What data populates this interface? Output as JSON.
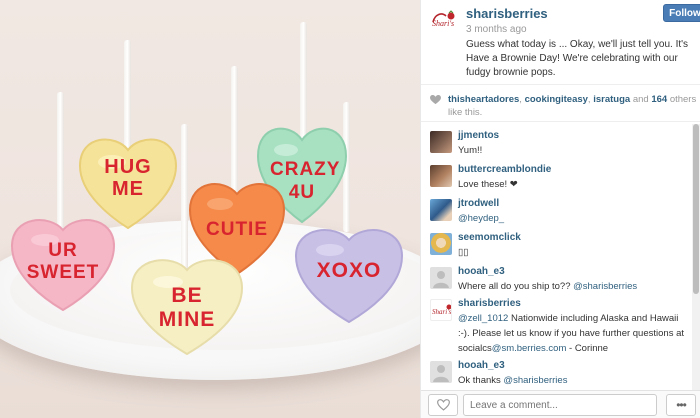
{
  "post": {
    "username": "sharisberries",
    "time": "3 months ago",
    "caption": "Guess what today is ... Okay, we'll just tell you. It's Have a Brownie Day! We're celebrating with our fudgy brownie pops.",
    "follow_label": "Follow",
    "logo_icon": "sharis-berries-logo"
  },
  "photo": {
    "candies": [
      {
        "text": "UR SWEET",
        "color": "#f5b6c6"
      },
      {
        "text": "HUG ME",
        "color": "#f6e39a"
      },
      {
        "text": "CUTIE",
        "color": "#f58a4a"
      },
      {
        "text": "CRAZY 4U",
        "color": "#a8e0c2"
      },
      {
        "text": "BE MINE",
        "color": "#f6efc4"
      },
      {
        "text": "XOXO",
        "color": "#c9c0e6"
      }
    ]
  },
  "likes": {
    "users": [
      "thisheartadores",
      "cookingiteasy",
      "isratuga"
    ],
    "count": "164",
    "sep1": ",",
    "sep2": ",",
    "and": "and",
    "suffix": "others like this.",
    "icon": "heart-icon"
  },
  "comments": [
    {
      "user": "jjmentos",
      "text": "Yum!!",
      "avatar": "#7a5a4a"
    },
    {
      "user": "buttercreamblondie",
      "text": "Love these! ❤︎",
      "avatar": "#9a6f52"
    },
    {
      "user": "jtrodwell",
      "text": "@heydep_",
      "avatar": "#3b6fa8"
    },
    {
      "user": "seemomclick",
      "text": "▯▯",
      "avatar": "#e4b84e"
    },
    {
      "user": "hooah_e3",
      "text": "Where all do you ship to?? @sharisberries",
      "avatar": "#d9d9d9"
    },
    {
      "user": "sharisberries",
      "text": "@zell_1012 Nationwide including Alaska and Hawaii :-). Please let us know if you have further questions at socialcs@sm.berries.com - Corinne",
      "avatar": "#ffffff"
    },
    {
      "user": "hooah_e3",
      "text": "Ok thanks @sharisberries",
      "avatar": "#d9d9d9"
    }
  ],
  "footer": {
    "comment_placeholder": "Leave a comment...",
    "more_label": "•••"
  },
  "colors": {
    "link": "#30607f",
    "follow_bg": "#4a7db5",
    "candy_text": "#d8242f"
  }
}
